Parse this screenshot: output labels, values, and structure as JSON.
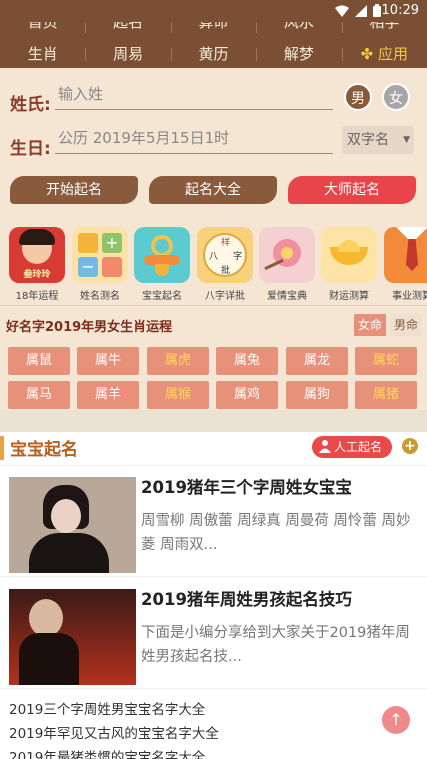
{
  "status": {
    "time": "10:29"
  },
  "nav": {
    "row1": [
      "首页",
      "起名",
      "算命",
      "风水",
      "相学"
    ],
    "row2": [
      "生肖",
      "周易",
      "黄历",
      "解梦"
    ],
    "apply": "应用"
  },
  "form": {
    "name_label": "姓氏:",
    "name_placeholder": "输入姓",
    "male": "男",
    "female": "女",
    "birth_label": "生日:",
    "birth_value": "公历 2019年5月15日1时",
    "select_value": "双字名",
    "actions": [
      "开始起名",
      "起名大全",
      "大师起名"
    ]
  },
  "apps": [
    {
      "label": "18年运程",
      "icon": "fortune-18-icon"
    },
    {
      "label": "姓名测名",
      "icon": "name-test-icon"
    },
    {
      "label": "宝宝起名",
      "icon": "baby-pacifier-icon"
    },
    {
      "label": "八字详批",
      "icon": "bazi-icon"
    },
    {
      "label": "爱情宝典",
      "icon": "love-flower-icon"
    },
    {
      "label": "财运测算",
      "icon": "wealth-ingot-icon"
    },
    {
      "label": "事业测算",
      "icon": "career-tie-icon"
    }
  ],
  "app_art": {
    "fortune_name": "叁玲玲",
    "bazi_chars": [
      "祥",
      "八",
      "字",
      "批"
    ]
  },
  "zodiac": {
    "title": "好名字2019年男女生肖运程",
    "tab_female": "女命",
    "tab_male": "男命",
    "items": [
      "属鼠",
      "属牛",
      "属虎",
      "属兔",
      "属龙",
      "属蛇",
      "属马",
      "属羊",
      "属猴",
      "属鸡",
      "属狗",
      "属猪"
    ],
    "highlighted": [
      "属虎",
      "属蛇",
      "属猴",
      "属猪"
    ]
  },
  "baby": {
    "title": "宝宝起名",
    "manual_button": "人工起名",
    "plus": "+",
    "articles": [
      {
        "title": "2019猪年三个字周姓女宝宝",
        "desc": "周雪柳 周傲蕾 周绿真 周曼荷 周怜蕾 周妙菱 周雨双..."
      },
      {
        "title": "2019猪年周姓男孩起名技巧",
        "desc": "下面是小编分享给到大家关于2019猪年周姓男孩起名技..."
      }
    ],
    "links": [
      "2019三个字周姓男宝宝名字大全",
      "2019年罕见又古风的宝宝名字大全",
      "2019年最猪类惯的宝宝名字大全"
    ]
  },
  "colors": {
    "nav_bg": "#7a4f33",
    "accent_red": "#e94949",
    "zodiac_btn": "#e8917a",
    "section_title": "#b8611d"
  }
}
